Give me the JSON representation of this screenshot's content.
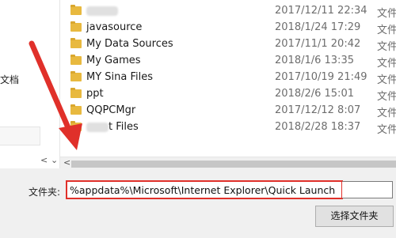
{
  "nav": {
    "label": "文档"
  },
  "files": [
    {
      "name": "",
      "date": "2017/12/11 22:34",
      "type": "文件夹",
      "name_blurred": true
    },
    {
      "name": "javasource",
      "date": "2018/1/24 17:29",
      "type": "文件夹"
    },
    {
      "name": "My Data Sources",
      "date": "2017/11/1 20:42",
      "type": "文件夹"
    },
    {
      "name": "My Games",
      "date": "2018/1/6 13:35",
      "type": "文件夹"
    },
    {
      "name": "MY Sina Files",
      "date": "2017/10/19 21:49",
      "type": "文件夹"
    },
    {
      "name": "ppt",
      "date": "2018/2/6 15:01",
      "type": "文件夹"
    },
    {
      "name": "QQPCMgr",
      "date": "2017/12/12 8:07",
      "type": "文件夹"
    },
    {
      "name": "t Files",
      "date": "2018/2/28 18:37",
      "type": "文件夹",
      "name_blurred": true
    }
  ],
  "folder": {
    "label": "文件夹:",
    "value": "%appdata%\\Microsoft\\Internet Explorer\\Quick Launch"
  },
  "actions": {
    "select_folder": "选择文件夹"
  },
  "colors": {
    "highlight": "#e0302a",
    "folder_icon": "#e8b93f"
  }
}
